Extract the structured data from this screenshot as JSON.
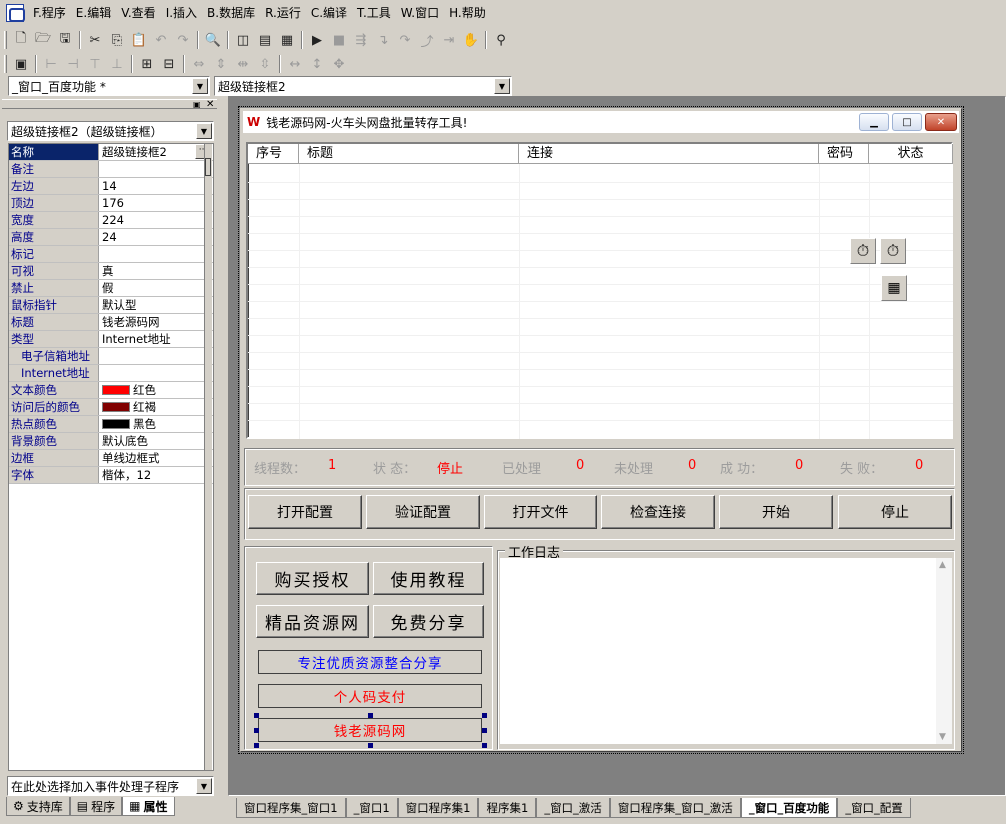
{
  "menu": [
    {
      "label": "F.程序"
    },
    {
      "label": "E.编辑"
    },
    {
      "label": "V.查看"
    },
    {
      "label": "I.插入"
    },
    {
      "label": "B.数据库"
    },
    {
      "label": "R.运行"
    },
    {
      "label": "C.编译"
    },
    {
      "label": "T.工具"
    },
    {
      "label": "W.窗口"
    },
    {
      "label": "H.帮助"
    }
  ],
  "toolbar": {
    "window_combo": "_窗口_百度功能 *",
    "control_combo": "超级链接框2"
  },
  "panel": {
    "object_combo": "超级链接框2（超级链接框）",
    "properties": [
      {
        "name": "名称",
        "value": "超级链接框2"
      },
      {
        "name": "备注",
        "value": ""
      },
      {
        "name": "左边",
        "value": "14"
      },
      {
        "name": "顶边",
        "value": "176"
      },
      {
        "name": "宽度",
        "value": "224"
      },
      {
        "name": "高度",
        "value": "24"
      },
      {
        "name": "标记",
        "value": ""
      },
      {
        "name": "可视",
        "value": "真"
      },
      {
        "name": "禁止",
        "value": "假"
      },
      {
        "name": "鼠标指针",
        "value": "默认型"
      },
      {
        "name": "标题",
        "value": "钱老源码网"
      },
      {
        "name": "类型",
        "value": "Internet地址"
      },
      {
        "name": "电子信箱地址",
        "value": ""
      },
      {
        "name": "Internet地址",
        "value": ""
      },
      {
        "name": "文本颜色",
        "value": "红色",
        "color": "#ff0000"
      },
      {
        "name": "访问后的颜色",
        "value": "红褐",
        "color": "#800000"
      },
      {
        "name": "热点颜色",
        "value": "黑色",
        "color": "#000000"
      },
      {
        "name": "背景颜色",
        "value": "默认底色"
      },
      {
        "name": "边框",
        "value": "单线边框式"
      },
      {
        "name": "字体",
        "value": "楷体，12"
      }
    ],
    "event_combo": "在此处选择加入事件处理子程序",
    "tabs": [
      "支持库",
      "程序",
      "属性"
    ]
  },
  "form": {
    "title": "钱老源码网-火车头网盘批量转存工具!",
    "columns": [
      "序号",
      "标题",
      "连接",
      "密码",
      "状态"
    ],
    "status": {
      "threads_label": "线程数：",
      "threads": "1",
      "state_label": "状  态：",
      "state": "停止",
      "processed_label": "已处理",
      "processed": "0",
      "unprocessed_label": "未处理",
      "unprocessed": "0",
      "success_label": "成  功：",
      "success": "0",
      "fail_label": "失  败：",
      "fail": "0"
    },
    "buttons": [
      "打开配置",
      "验证配置",
      "打开文件",
      "检查连接",
      "开始",
      "停止"
    ],
    "left_buttons": [
      "购买授权",
      "使用教程",
      "精品资源网",
      "免费分享"
    ],
    "links": [
      "专注优质资源整合分享",
      "个人码支付",
      "钱老源码网"
    ],
    "log_label": "工作日志"
  },
  "bottom_tabs": [
    "窗口程序集_窗口1",
    "_窗口1",
    "窗口程序集1",
    "程序集1",
    "_窗口_激活",
    "窗口程序集_窗口_激活",
    "_窗口_百度功能",
    "_窗口_配置"
  ],
  "colors": {
    "link_blue": "#0000ff",
    "link_red": "#ff0000",
    "selection": "#0a246a"
  }
}
